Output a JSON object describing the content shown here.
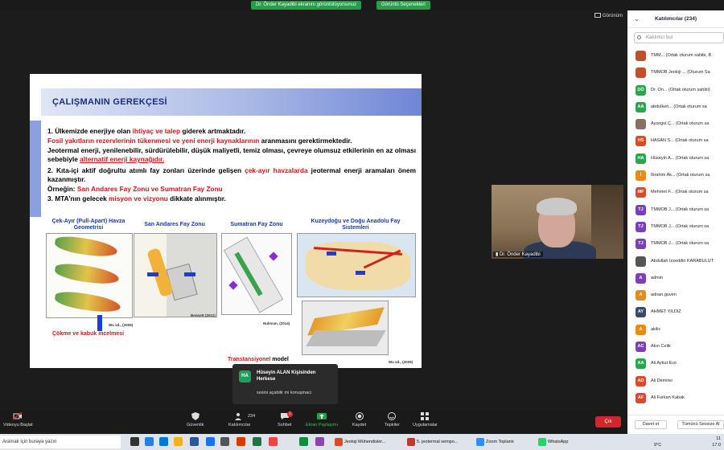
{
  "top": {
    "share_banner": "Dr. Önder Kayadibi ekranını görüntülüyorsunuz",
    "view_options": "Görüntü Seçenekleri",
    "view_button": "Görünüm"
  },
  "slide": {
    "title": "ÇALIŞMANIN GEREKÇESİ",
    "p1_a": "1. Ülkemizde enerjiye olan ",
    "p1_red": "ihtiyaç ve talep",
    "p1_b": " giderek artmaktadır.",
    "p2_red": "Fosil yakıtların rezervlerinin tükenmesi ve yeni enerji kaynaklarının",
    "p2_b": " aranmasını gerektirmektedir.",
    "p3": "Jeotermal enerji, yenilenebilir, sürdürülebilir, düşük maliyetli, temiz olması, çevreye olumsuz etkilerinin en az olması sebebiyle ",
    "p3_red": "alternatif enerji kaynağıdır.",
    "p4_a": "2. Kıta-içi aktif doğrultu atımlı fay zonları üzerinde gelişen ",
    "p4_red": "çek-ayır havzalarda",
    "p4_b": " jeotermal enerji aramaları önem kazanmıştır.",
    "p5_a": "Örneğin: ",
    "p5_red": "San Andares Fay Zonu ve Sumatran Fay Zonu",
    "p6_a": "3. MTA'nın gelecek ",
    "p6_red": "misyon ve vizyonu",
    "p6_b": " dikkate alınmıştır.",
    "fig1_label": "Çek-Ayır (Pull-Apart) Havza Geometrisi",
    "fig2_label": "San Andares Fay Zonu",
    "fig3_label": "Sumatran Fay Zonu",
    "fig4_label": "Kuzeydoğu ve Doğu Anadolu Fay Sistemleri",
    "cite1": "Wu vd., (2009)",
    "cite2": "Bennett (2011)",
    "cite3": "Nukman, (2014)",
    "cite4": "Wu vd., (2009)",
    "caption1": "Çökme ve kabuk incelmesi",
    "caption2_red": "Transtansiyonel",
    "caption2_b": " model"
  },
  "cam": {
    "name": "Dr. Önder Kayadibi"
  },
  "notification": {
    "initials": "HA",
    "title": "Hüseyin ALAN Kişisinden Herkese",
    "message": "sesini açabilir mi konuşmacı"
  },
  "toolbar": {
    "video": "Videoyu Başlat",
    "security": "Güvenlik",
    "participants": "Katılımcılar",
    "participant_count": "234",
    "chat": "Sohbet",
    "chat_badge": "1",
    "share": "Ekran Paylaşımı",
    "record": "Kaydet",
    "reactions": "Tepkiler",
    "apps": "Uygulamalar",
    "leave": "Çık"
  },
  "panel": {
    "title": "Katılımcılar (234)",
    "search_placeholder": "Katılımcı bul",
    "invite": "Davet et",
    "mute_all": "Tümünü Sessize Al",
    "participants": [
      {
        "initials": "",
        "name": "TMM... (Ortak oturum sahibi, B",
        "color": "#c0502a"
      },
      {
        "initials": "",
        "name": "TMMOB Jeoloji ... (Oturum Sa",
        "color": "#c0502a"
      },
      {
        "initials": "DÖ",
        "name": "Dr. Ön... (Ortak oturum sahibi)",
        "color": "#2da44e"
      },
      {
        "initials": "AA",
        "name": "abdulkeri... (Ortak oturum sa",
        "color": "#2da44e"
      },
      {
        "initials": "",
        "name": "Aysegul Ç... (Ortak oturum sa",
        "color": "#8a7060"
      },
      {
        "initials": "HS",
        "name": "HASAN S... (Ortak oturum sa",
        "color": "#d94a2a"
      },
      {
        "initials": "HA",
        "name": "Hüseyin A... (Ortak oturum sa",
        "color": "#2da44e"
      },
      {
        "initials": "İ",
        "name": "İbrahim Ak... (Ortak oturum sa",
        "color": "#e58b16"
      },
      {
        "initials": "MF",
        "name": "Mehmet F... (Ortak oturum sa",
        "color": "#d94a2a"
      },
      {
        "initials": "TJ",
        "name": "TMMOB J... (Ortak oturum sa",
        "color": "#7b3fb6"
      },
      {
        "initials": "TJ",
        "name": "TMMOB J... (Ortak oturum sa",
        "color": "#7b3fb6"
      },
      {
        "initials": "TJ",
        "name": "TMMOB J... (Ortak oturum sa",
        "color": "#7b3fb6"
      },
      {
        "initials": "",
        "name": "Abdullah İzzeddin KARABULUT",
        "color": "#555555"
      },
      {
        "initials": "A",
        "name": "admin",
        "color": "#7b3fb6"
      },
      {
        "initials": "A",
        "name": "adnan.guven",
        "color": "#e58b16"
      },
      {
        "initials": "AY",
        "name": "AHMET YILDIZ",
        "color": "#3a4a6a"
      },
      {
        "initials": "A",
        "name": "akilic",
        "color": "#e58b16"
      },
      {
        "initials": "AC",
        "name": "Akın Celik",
        "color": "#7b3fb6"
      },
      {
        "initials": "AA",
        "name": "Ali Aykut Ece",
        "color": "#2da44e"
      },
      {
        "initials": "AD",
        "name": "Ali Demirer",
        "color": "#d94a2a"
      },
      {
        "initials": "AF",
        "name": "Ali Furkan Kabak",
        "color": "#d94a2a"
      }
    ]
  },
  "taskbar": {
    "search": "Aramak için buraya yazın",
    "apps": [
      {
        "label": "Jeoloji Mühendisler...",
        "color": "#d94a2a"
      },
      {
        "label": "5. jeotermal sempo...",
        "color": "#c0392b"
      },
      {
        "label": "Zoom Toplantı",
        "color": "#2d8cff"
      },
      {
        "label": "WhatsApp",
        "color": "#25d366"
      }
    ],
    "temp": "9°C",
    "time": "11",
    "date": "17.0"
  }
}
